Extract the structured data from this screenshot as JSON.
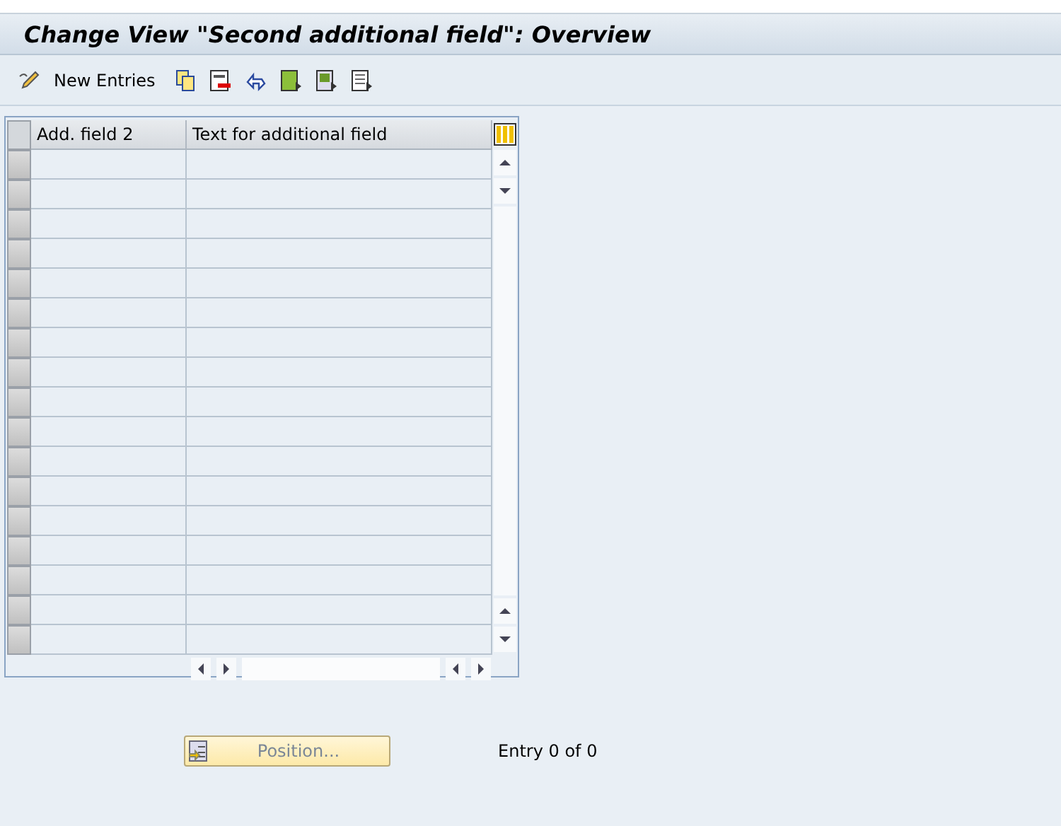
{
  "window": {
    "title": "Change View \"Second additional field\": Overview"
  },
  "toolbar": {
    "new_entries": "New Entries"
  },
  "table": {
    "columns": [
      "Add. field 2",
      "Text for additional field"
    ]
  },
  "footer": {
    "position_button": "Position...",
    "entry_count": "Entry 0 of 0"
  }
}
